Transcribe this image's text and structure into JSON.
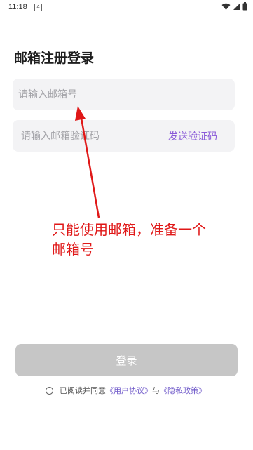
{
  "status_bar": {
    "time": "11:18",
    "notification_glyph": "A",
    "icons": [
      "wifi-icon",
      "signal-icon",
      "battery-icon"
    ]
  },
  "page": {
    "title": "邮箱注册登录"
  },
  "form": {
    "email_placeholder": "请输入邮箱号",
    "code_placeholder": "请输入邮箱验证码",
    "send_code_label": "发送验证码",
    "login_label": "登录"
  },
  "agreement": {
    "prefix": "已阅读并同意",
    "user_agreement": "《用户协议》",
    "joiner": "与",
    "privacy_policy": "《隐私政策》"
  },
  "annotation": {
    "text": "只能使用邮箱，准备一个邮箱号"
  },
  "colors": {
    "accent": "#8a5ad8",
    "annotation": "#e01818",
    "login_disabled": "#c6c6c6",
    "field_bg": "#f3f3f5"
  }
}
